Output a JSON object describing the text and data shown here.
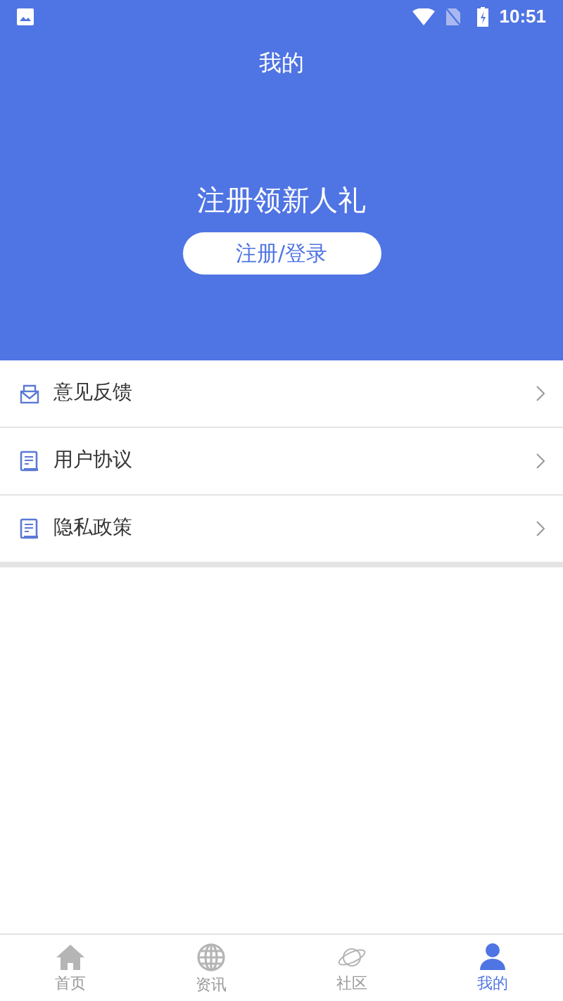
{
  "status_bar": {
    "time": "10:51"
  },
  "header": {
    "title": "我的",
    "promo": "注册领新人礼",
    "button": "注册/登录"
  },
  "menu": [
    {
      "label": "意见反馈",
      "kind": "mail"
    },
    {
      "label": "用户协议",
      "kind": "document"
    },
    {
      "label": "隐私政策",
      "kind": "document"
    }
  ],
  "tabs": [
    {
      "label": "首页",
      "kind": "home",
      "selected": false
    },
    {
      "label": "资讯",
      "kind": "globe",
      "selected": false
    },
    {
      "label": "社区",
      "kind": "planet",
      "selected": false
    },
    {
      "label": "我的",
      "kind": "user",
      "selected": true
    }
  ]
}
